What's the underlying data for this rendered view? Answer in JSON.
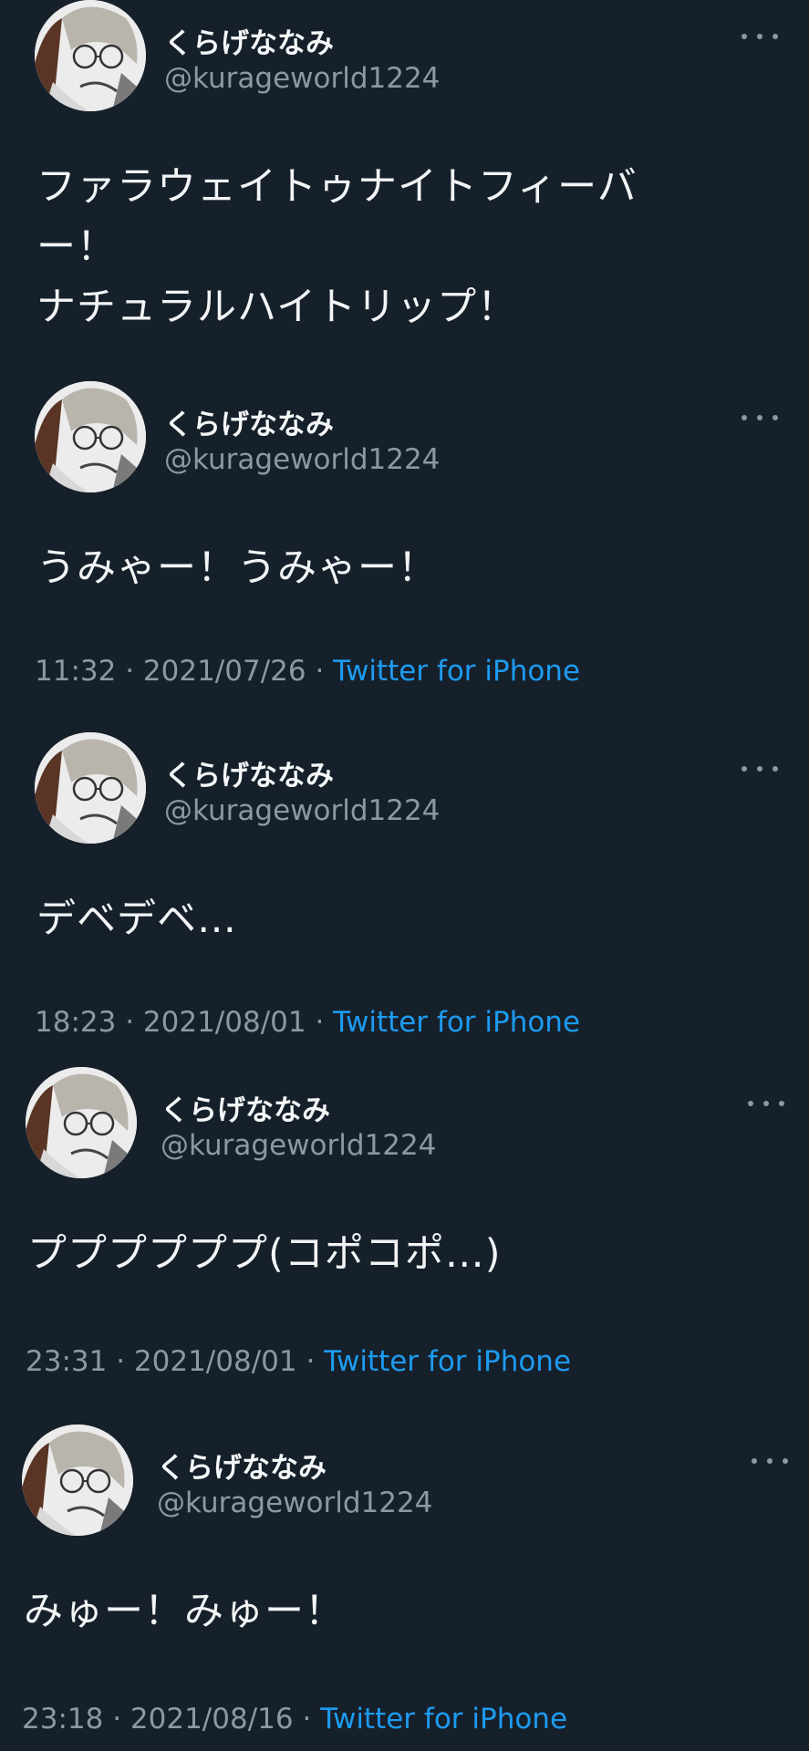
{
  "tweets": [
    {
      "name": "くらげななみ",
      "handle": "@kurageworld1224",
      "text": "ファラウェイトゥナイトフィーバ\nー！\nナチュラルハイトリップ！",
      "time": "",
      "date": "",
      "source": ""
    },
    {
      "name": "くらげななみ",
      "handle": "@kurageworld1224",
      "text": "うみゃー！うみゃー！",
      "time": "11:32",
      "date": "2021/07/26",
      "source": "Twitter for iPhone"
    },
    {
      "name": "くらげななみ",
      "handle": "@kurageworld1224",
      "text": "デベデベ…",
      "time": "18:23",
      "date": "2021/08/01",
      "source": "Twitter for iPhone"
    },
    {
      "name": "くらげななみ",
      "handle": "@kurageworld1224",
      "text": "ププププププ(コポコポ…)",
      "time": "23:31",
      "date": "2021/08/01",
      "source": "Twitter for iPhone"
    },
    {
      "name": "くらげななみ",
      "handle": "@kurageworld1224",
      "text": "みゅー！みゅー！",
      "time": "23:18",
      "date": "2021/08/16",
      "source": "Twitter for iPhone"
    }
  ],
  "separator": " · ",
  "icons": {
    "avatar": "avatar-illustration",
    "more": "more-options-icon"
  },
  "colors": {
    "background": "#16202b",
    "name": "#f5f7f8",
    "secondary": "#8b98a5",
    "link": "#1d9bf0"
  }
}
